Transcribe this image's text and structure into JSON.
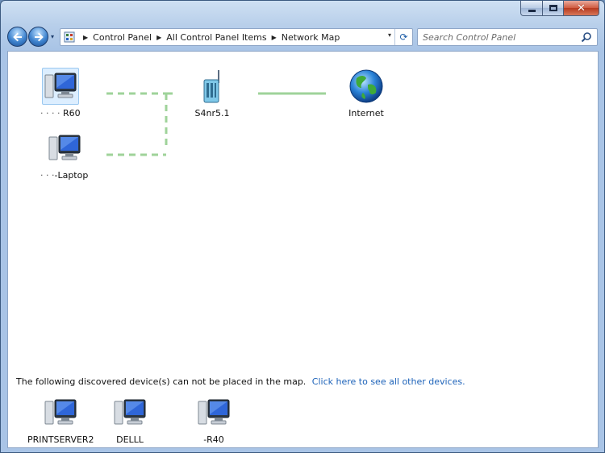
{
  "window": {
    "caption": {
      "minimize": "–",
      "maximize": "□",
      "close": "✕"
    }
  },
  "nav": {
    "back_label": "◀",
    "forward_label": "▶",
    "recent_label": "▾"
  },
  "address": {
    "crumbs": [
      "Control Panel",
      "All Control Panel Items",
      "Network Map"
    ],
    "dropdown": "▾",
    "refresh": "⟳"
  },
  "search": {
    "placeholder": "Search Control Panel"
  },
  "map": {
    "nodes": [
      {
        "id": "computer-1",
        "label": "R60",
        "label_prefix": "· · · ·",
        "type": "computer",
        "selected": true
      },
      {
        "id": "laptop",
        "label": "-Laptop",
        "label_prefix": "· · ·",
        "type": "computer",
        "selected": false
      },
      {
        "id": "router",
        "label": "S4nr5.1",
        "type": "router",
        "selected": false
      },
      {
        "id": "internet",
        "label": "Internet",
        "type": "globe",
        "selected": false
      }
    ],
    "links": [
      {
        "from": "computer-1",
        "to": "router",
        "style": "wireless"
      },
      {
        "from": "laptop",
        "to": "router",
        "style": "wireless"
      },
      {
        "from": "router",
        "to": "internet",
        "style": "wired"
      }
    ]
  },
  "discovered": {
    "notice": "The following discovered device(s) can not be placed in the map.",
    "link": "Click here to see all other devices.",
    "devices": [
      {
        "label": "PRINTSERVER2"
      },
      {
        "label": "DELLL"
      },
      {
        "label": "-R40"
      }
    ]
  },
  "colors": {
    "wireless_link": "#9fd39a",
    "wired_link": "#9fd39a",
    "link_text": "#1c62b9"
  }
}
